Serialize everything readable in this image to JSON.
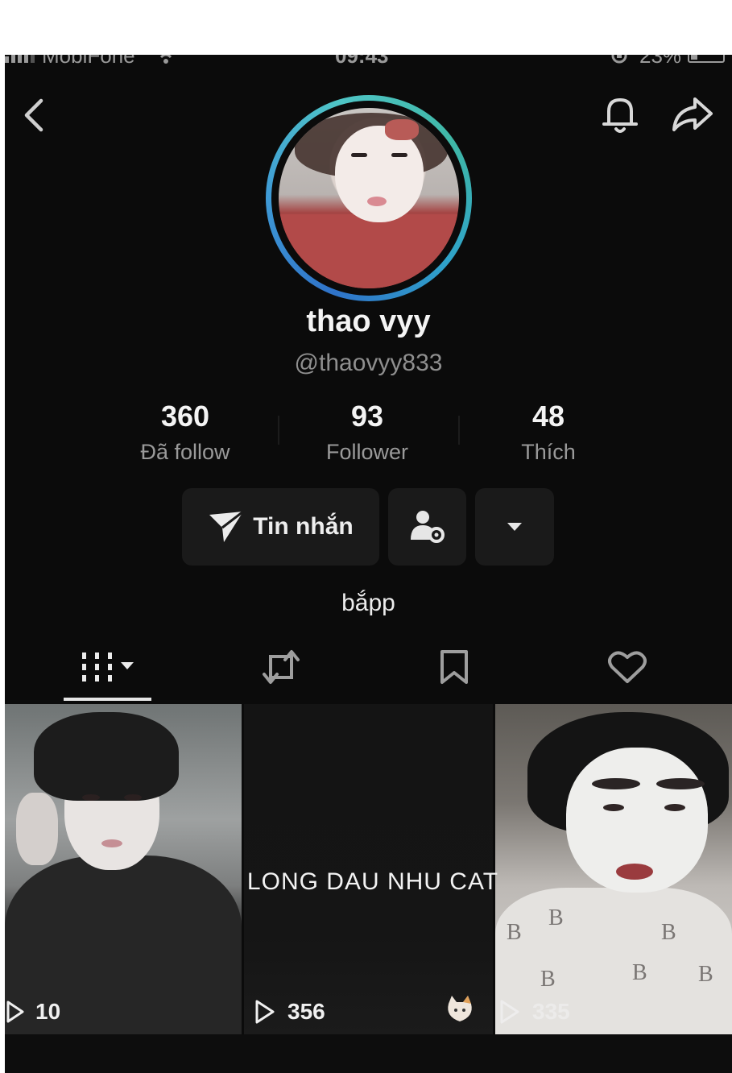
{
  "status_bar": {
    "carrier": "MobiFone",
    "time": "09:43",
    "battery_pct": "23%"
  },
  "header": {
    "back_icon": "chevron-left-icon",
    "bell_icon": "bell-icon",
    "share_icon": "share-arrow-icon"
  },
  "profile": {
    "display_name": "thao vyy",
    "username": "@thaovyy833",
    "bio": "bắpp",
    "avatar_ring_colors": [
      "#2f73c9",
      "#4fc5c6"
    ]
  },
  "stats": [
    {
      "value": "360",
      "label": "Đã follow"
    },
    {
      "value": "93",
      "label": "Follower"
    },
    {
      "value": "48",
      "label": "Thích"
    }
  ],
  "actions": {
    "message_label": "Tin nhắn",
    "message_icon": "send-arrow-icon",
    "friend_icon": "user-settings-icon",
    "more_icon": "caret-down-icon"
  },
  "tabs": [
    {
      "icon": "grid-videos-icon",
      "selected": true
    },
    {
      "icon": "repost-icon",
      "selected": false
    },
    {
      "icon": "bookmark-icon",
      "selected": false
    },
    {
      "icon": "heart-icon",
      "selected": false
    }
  ],
  "videos": [
    {
      "views": "10"
    },
    {
      "views": "356",
      "overlay_text": "LONG DAU NHU CAT"
    },
    {
      "views": "335"
    }
  ],
  "colors": {
    "background": "#0b0b0b",
    "button_bg": "#1a1a1a",
    "muted_text": "#9a9a9a"
  }
}
